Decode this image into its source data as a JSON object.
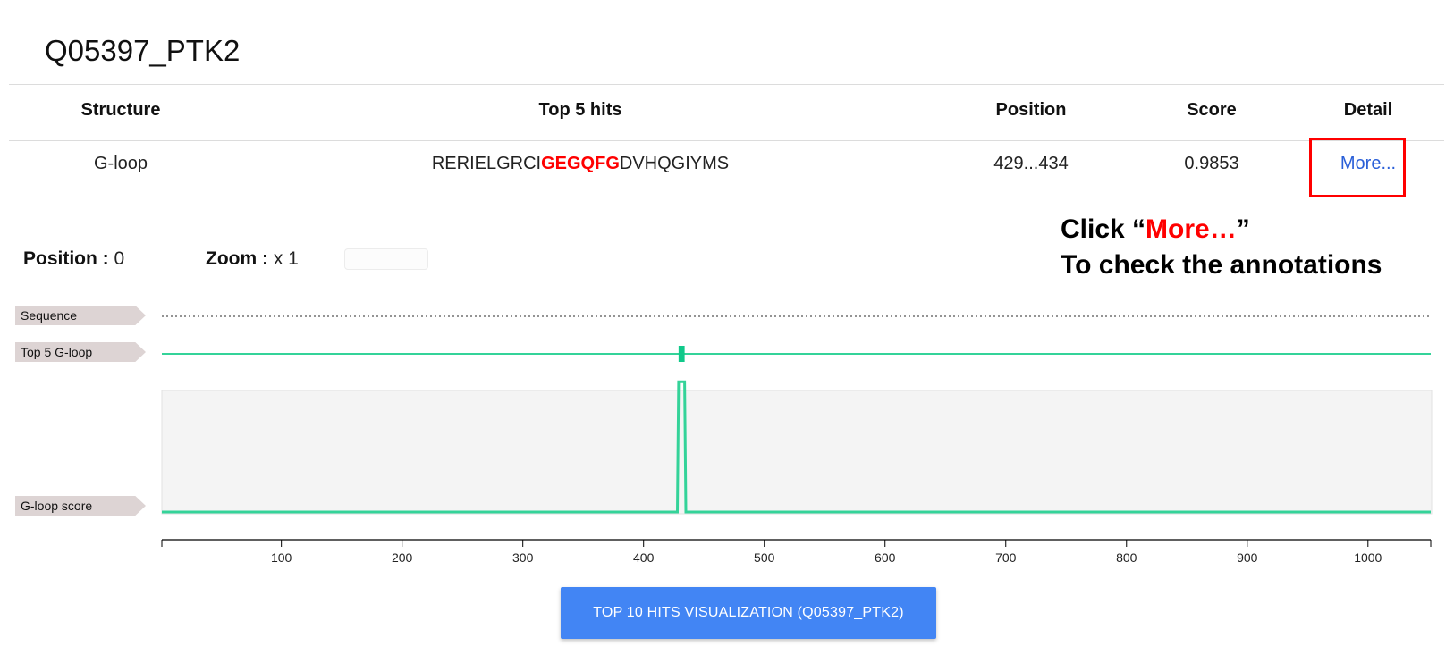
{
  "protein_title": "Q05397_PTK2",
  "table": {
    "headers": [
      "Structure",
      "Top 5 hits",
      "Position",
      "Score",
      "Detail"
    ],
    "row": {
      "structure": "G-loop",
      "hit_prefix": "RERIELGRCI",
      "hit_motif": "GEGQFG",
      "hit_suffix": "DVHQGIYMS",
      "position": "429...434",
      "score": "0.9853",
      "detail_link": "More..."
    }
  },
  "annotation": {
    "line1_prefix": "Click “",
    "line1_highlight": "More…",
    "line1_suffix": "”",
    "line2": "To check the annotations"
  },
  "controls": {
    "position_label": "Position :",
    "position_value": "0",
    "zoom_label": "Zoom :",
    "zoom_value": "x 1"
  },
  "tracks": {
    "sequence_label": "Sequence",
    "top5_label": "Top 5 G-loop",
    "score_label": "G-loop score"
  },
  "chart_data": {
    "type": "line",
    "sequence_length": 1052,
    "top5_marker": {
      "start": 429,
      "end": 434
    },
    "score_series": {
      "x": [
        1,
        428,
        429,
        431,
        434,
        435,
        1052
      ],
      "y": [
        0,
        0,
        0.9853,
        0.9853,
        0.9853,
        0,
        0
      ],
      "ylim": [
        0,
        1
      ]
    },
    "xticks": [
      100,
      200,
      300,
      400,
      500,
      600,
      700,
      800,
      900,
      1000
    ],
    "xlim": [
      1,
      1052
    ]
  },
  "button": {
    "label": "TOP 10 HITS VISUALIZATION (Q05397_PTK2)"
  },
  "colors": {
    "track": "#34d399",
    "motif": "#ff0000",
    "link": "#2a5fd8",
    "button": "#4285f4"
  }
}
